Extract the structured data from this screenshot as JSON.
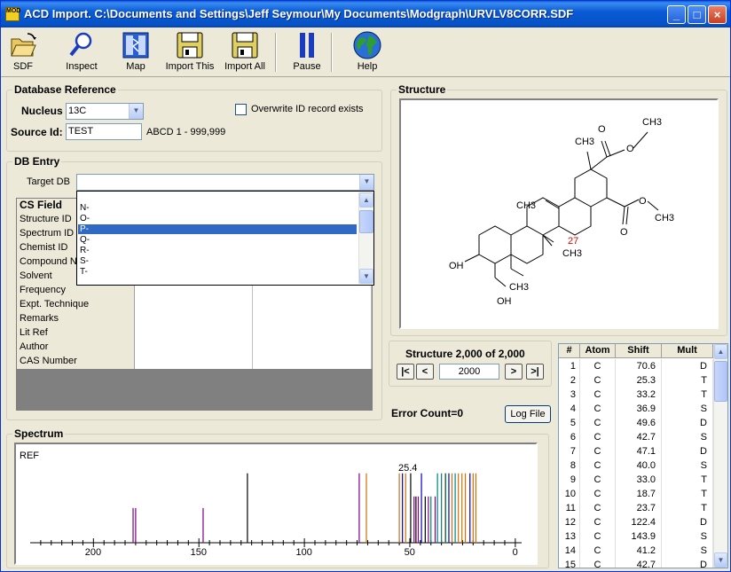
{
  "window": {
    "title": "ACD Import. C:\\Documents and Settings\\Jeff Seymour\\My Documents\\Modgraph\\URVLV8CORR.SDF",
    "app_icon_text": "MOD",
    "minimize": "_",
    "maximize": "□",
    "close": "×"
  },
  "toolbar": {
    "items": [
      {
        "label": "SDF",
        "icon": "folder-open-icon"
      },
      {
        "label": "Inspect",
        "icon": "magnifier-icon"
      },
      {
        "label": "Map",
        "icon": "map-icon"
      },
      {
        "label": "Import This",
        "icon": "floppy-disk-icon"
      },
      {
        "label": "Import All",
        "icon": "floppy-disk-icon"
      },
      {
        "label": "Pause",
        "icon": "pause-icon"
      },
      {
        "label": "Help",
        "icon": "globe-icon"
      }
    ]
  },
  "db_reference": {
    "title": "Database Reference",
    "nucleus_label": "Nucleus",
    "nucleus_value": "13C",
    "overwrite_label": "Overwrite ID record exists",
    "source_id_label": "Source Id:",
    "source_id_value": "TEST",
    "source_hint": "ABCD  1 - 999,999"
  },
  "db_entry": {
    "title": "DB Entry",
    "target_db_label": "Target DB",
    "target_db_value": "",
    "dropdown_items": [
      "N-",
      "O-",
      "P-",
      "Q-",
      "R-",
      "S-",
      "T-"
    ],
    "dropdown_selected": "P-",
    "grid_header": "CS Field",
    "grid_rows": [
      "Structure ID",
      "Spectrum ID",
      "Chemist ID",
      "Compound N",
      "Solvent",
      "Frequency",
      "Expt. Technique",
      "Remarks",
      "Lit Ref",
      "Author",
      "CAS Number"
    ]
  },
  "structure": {
    "title": "Structure",
    "atom_labels": {
      "ch3_ester_top": "CH3",
      "ch3_top": "CH3",
      "o_top": "O",
      "o_top2": "O",
      "o_right1": "O",
      "o_right2": "O",
      "ch3_right": "CH3",
      "ch3_mid": "CH3",
      "ch3_lower": "CH3",
      "ch3_bottom": "CH3",
      "oh_left": "OH",
      "oh_bottom": "OH",
      "highlight_number": "27"
    },
    "counter": "Structure 2,000 of 2,000",
    "nav_first": "|<",
    "nav_prev": "<",
    "nav_value": "2000",
    "nav_next": ">",
    "nav_last": ">|"
  },
  "error_count": "Error Count=0",
  "log_file_button": "Log File",
  "shift_table": {
    "headers": [
      "#",
      "Atom",
      "Shift",
      "Mult"
    ],
    "rows": [
      [
        "1",
        "C",
        "70.6",
        "D"
      ],
      [
        "2",
        "C",
        "25.3",
        "T"
      ],
      [
        "3",
        "C",
        "33.2",
        "T"
      ],
      [
        "4",
        "C",
        "36.9",
        "S"
      ],
      [
        "5",
        "C",
        "49.6",
        "D"
      ],
      [
        "6",
        "C",
        "42.7",
        "S"
      ],
      [
        "7",
        "C",
        "47.1",
        "D"
      ],
      [
        "8",
        "C",
        "40.0",
        "S"
      ],
      [
        "9",
        "C",
        "33.0",
        "T"
      ],
      [
        "10",
        "C",
        "18.7",
        "T"
      ],
      [
        "11",
        "C",
        "23.7",
        "T"
      ],
      [
        "12",
        "C",
        "122.4",
        "D"
      ],
      [
        "13",
        "C",
        "143.9",
        "S"
      ],
      [
        "14",
        "C",
        "41.2",
        "S"
      ],
      [
        "15",
        "C",
        "42.7",
        "D"
      ]
    ]
  },
  "spectrum": {
    "title": "Spectrum",
    "ref_label": "REF",
    "peak_label": "25.4",
    "ticks": [
      "200",
      "150",
      "100",
      "50",
      "0"
    ]
  },
  "chart_data": {
    "type": "bar",
    "xlabel": "",
    "ylabel": "",
    "xlim": [
      230,
      -3
    ],
    "reversed_x": true,
    "ticks": [
      200,
      150,
      100,
      50,
      0
    ],
    "peak_annotation": "25.4",
    "peaks": [
      {
        "x": 181.2,
        "h": 0.45,
        "c": "#800080"
      },
      {
        "x": 180.0,
        "h": 0.45,
        "c": "#800080"
      },
      {
        "x": 148.0,
        "h": 0.45,
        "c": "#800080"
      },
      {
        "x": 127.0,
        "h": 0.9,
        "c": "#000000"
      },
      {
        "x": 74.0,
        "h": 0.9,
        "c": "#800080"
      },
      {
        "x": 70.6,
        "h": 0.9,
        "c": "#d07000"
      },
      {
        "x": 55.0,
        "h": 0.9,
        "c": "#d07000"
      },
      {
        "x": 53.5,
        "h": 0.9,
        "c": "#0000c0"
      },
      {
        "x": 52.0,
        "h": 0.9,
        "c": "#d07000"
      },
      {
        "x": 49.6,
        "h": 0.9,
        "c": "#000000"
      },
      {
        "x": 48.0,
        "h": 0.6,
        "c": "#800080"
      },
      {
        "x": 47.1,
        "h": 0.6,
        "c": "#000000"
      },
      {
        "x": 46.0,
        "h": 0.6,
        "c": "#800080"
      },
      {
        "x": 44.5,
        "h": 0.9,
        "c": "#0000c0"
      },
      {
        "x": 42.7,
        "h": 0.6,
        "c": "#000000"
      },
      {
        "x": 41.2,
        "h": 0.6,
        "c": "#800080"
      },
      {
        "x": 40.0,
        "h": 0.6,
        "c": "#008080"
      },
      {
        "x": 38.0,
        "h": 0.6,
        "c": "#800080"
      },
      {
        "x": 36.9,
        "h": 0.9,
        "c": "#008080"
      },
      {
        "x": 35.0,
        "h": 0.9,
        "c": "#008080"
      },
      {
        "x": 33.2,
        "h": 0.9,
        "c": "#d07000"
      },
      {
        "x": 33.0,
        "h": 0.9,
        "c": "#008080"
      },
      {
        "x": 31.5,
        "h": 0.9,
        "c": "#0000c0"
      },
      {
        "x": 30.0,
        "h": 0.9,
        "c": "#d07000"
      },
      {
        "x": 28.5,
        "h": 0.9,
        "c": "#008080"
      },
      {
        "x": 27.0,
        "h": 0.9,
        "c": "#d07000"
      },
      {
        "x": 25.3,
        "h": 0.9,
        "c": "#d07000"
      },
      {
        "x": 23.7,
        "h": 0.9,
        "c": "#d07000"
      },
      {
        "x": 21.5,
        "h": 0.9,
        "c": "#0000c0"
      },
      {
        "x": 20.0,
        "h": 0.9,
        "c": "#d07000"
      },
      {
        "x": 18.7,
        "h": 0.9,
        "c": "#d07000"
      }
    ]
  }
}
